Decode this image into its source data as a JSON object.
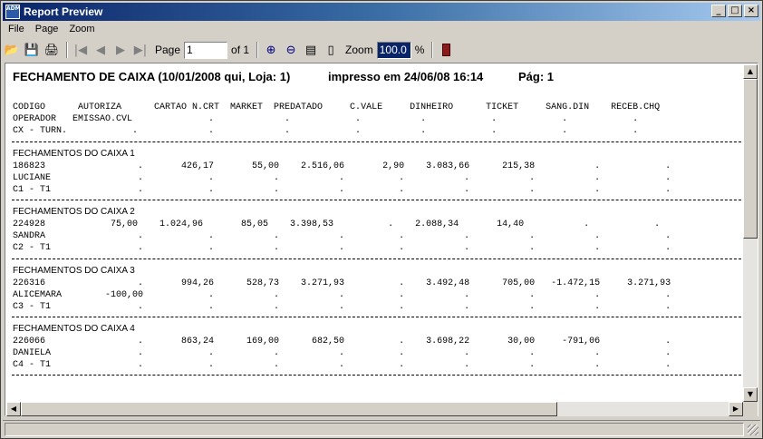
{
  "window": {
    "title": "Report Preview",
    "icon_text": "ADM"
  },
  "menu": [
    "File",
    "Page",
    "Zoom"
  ],
  "toolbar": {
    "page_label": "Page",
    "page_value": "1",
    "of_label": "of 1",
    "zoom_label": "Zoom",
    "zoom_value": "100.0",
    "percent": "%"
  },
  "report": {
    "title": "FECHAMENTO DE CAIXA (10/01/2008 qui, Loja: 1)",
    "printed": "impresso em 24/06/08 16:14",
    "page": "Pág: 1",
    "header_lines": [
      "CODIGO      AUTORIZA      CARTAO N.CRT  MARKET  PREDATADO     C.VALE     DINHEIRO      TICKET     SANG.DIN    RECEB.CHQ",
      "OPERADOR   EMISSAO.CVL              .             .            .           .            .            .            .",
      "CX - TURN.            .             .             .            .           .            .            .            ."
    ],
    "sections": [
      {
        "title": "FECHAMENTOS DO CAIXA 1",
        "lines": [
          "186823                 .       426,17       55,00    2.516,06       2,90    3.083,66      215,38           .            .",
          "LUCIANE                .            .           .           .          .           .           .           .            .",
          "C1 - T1                .            .           .           .          .           .           .           .            ."
        ]
      },
      {
        "title": "FECHAMENTOS DO CAIXA 2",
        "lines": [
          "224928            75,00    1.024,96       85,05    3.398,53          .    2.088,34       14,40           .            .",
          "SANDRA                 .            .           .           .          .           .           .           .            .",
          "C2 - T1                .            .           .           .          .           .           .           .            ."
        ]
      },
      {
        "title": "FECHAMENTOS DO CAIXA 3",
        "lines": [
          "226316                 .       994,26      528,73    3.271,93          .    3.492,48      705,00   -1.472,15     3.271,93",
          "ALICEMARA        -100,00            .           .           .          .           .           .           .            .",
          "C3 - T1                .            .           .           .          .           .           .           .            ."
        ]
      },
      {
        "title": "FECHAMENTOS DO CAIXA 4",
        "lines": [
          "226066                 .       863,24      169,00      682,50          .    3.698,22       30,00     -791,06            .",
          "DANIELA                .            .           .           .          .           .           .           .            .",
          "C4 - T1                .            .           .           .          .           .           .           .            ."
        ]
      }
    ]
  }
}
